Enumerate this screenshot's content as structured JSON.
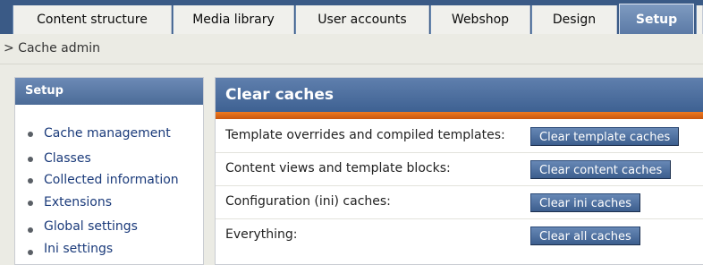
{
  "tabs": [
    {
      "label": "Content structure",
      "active": false
    },
    {
      "label": "Media library",
      "active": false
    },
    {
      "label": "User accounts",
      "active": false
    },
    {
      "label": "Webshop",
      "active": false
    },
    {
      "label": "Design",
      "active": false
    },
    {
      "label": "Setup",
      "active": true
    }
  ],
  "breadcrumb": "> Cache admin",
  "sidebar": {
    "title": "Setup",
    "items": [
      {
        "label": "Cache management"
      },
      {
        "label": "Classes"
      },
      {
        "label": "Collected information"
      },
      {
        "label": "Extensions"
      },
      {
        "label": "Global settings"
      },
      {
        "label": "Ini settings"
      }
    ]
  },
  "main": {
    "title": "Clear caches",
    "rows": [
      {
        "label": "Template overrides and compiled templates:",
        "button": "Clear template caches"
      },
      {
        "label": "Content views and template blocks:",
        "button": "Clear content caches"
      },
      {
        "label": "Configuration (ini) caches:",
        "button": "Clear ini caches"
      },
      {
        "label": "Everything:",
        "button": "Clear all caches"
      }
    ]
  },
  "colors": {
    "tab_bar": "#3a5a86",
    "header_blue": "#4b6b97",
    "accent_orange": "#e8731c",
    "link": "#1a3a7a"
  }
}
